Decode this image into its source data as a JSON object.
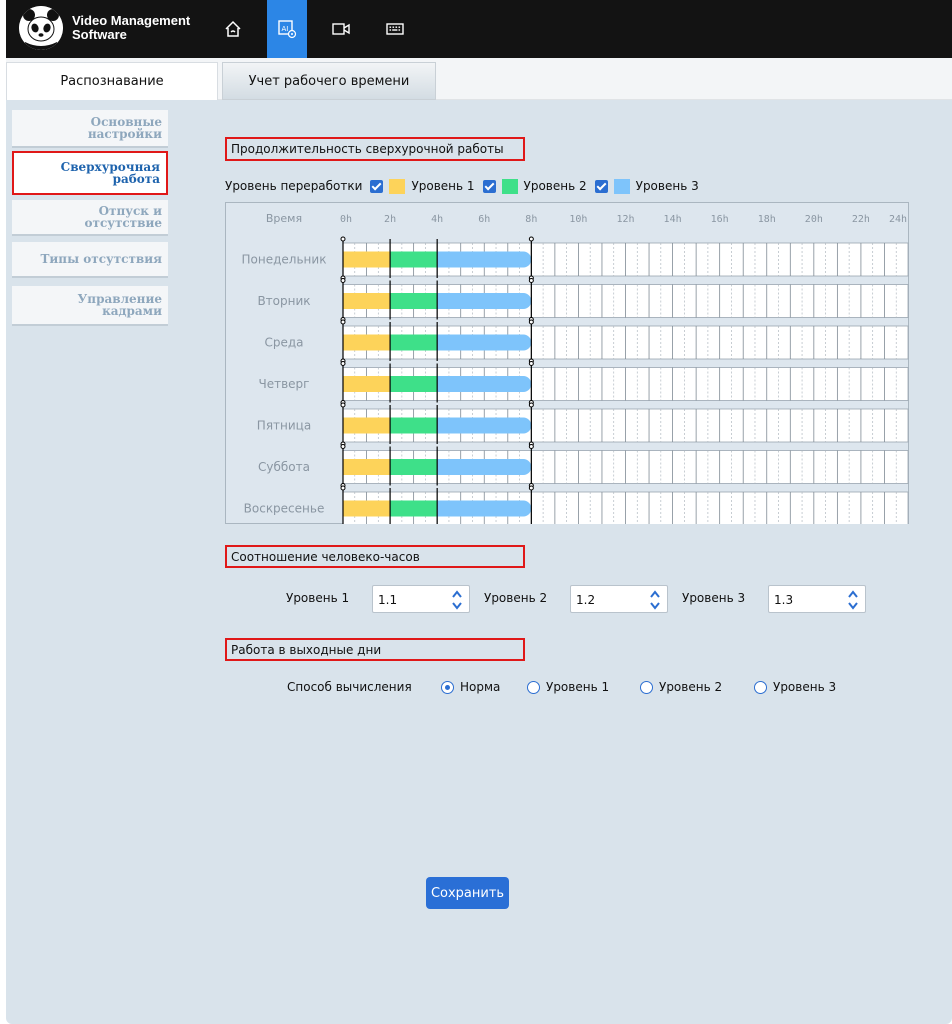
{
  "app": {
    "title_line1": "Video Management",
    "title_line2": "Software",
    "accent_color": "#2c86e6"
  },
  "nav": [
    {
      "icon": "home-icon"
    },
    {
      "icon": "ai-settings-icon",
      "active": true
    },
    {
      "icon": "video-camera-icon"
    },
    {
      "icon": "keyboard-icon"
    }
  ],
  "tabs": [
    {
      "label": "Распознавание",
      "active": true
    },
    {
      "label": "Учет рабочего времени",
      "active": false
    }
  ],
  "sidebar": {
    "items": [
      {
        "line1": "Основные",
        "line2": "настройки"
      },
      {
        "line1": "Сверхурочная",
        "line2": "работа",
        "active": true
      },
      {
        "line1": "Отпуск и",
        "line2": "отсутствие"
      },
      {
        "line1": "Типы отсутствия",
        "line2": ""
      },
      {
        "line1": "Управление",
        "line2": "кадрами"
      }
    ]
  },
  "overtime": {
    "section_title": "Продолжительность сверхурочной работы",
    "level_label": "Уровень переработки",
    "levels": [
      {
        "label": "Уровень 1",
        "checked": true,
        "color": "#fdd35a"
      },
      {
        "label": "Уровень 2",
        "checked": true,
        "color": "#3ee089"
      },
      {
        "label": "Уровень 3",
        "checked": true,
        "color": "#7ec4fb"
      }
    ],
    "time_header": "Время",
    "hour_ticks": [
      "0h",
      "2h",
      "4h",
      "6h",
      "8h",
      "10h",
      "12h",
      "14h",
      "16h",
      "18h",
      "20h",
      "22h",
      "24h"
    ],
    "days": [
      "Понедельник",
      "Вторник",
      "Среда",
      "Четверг",
      "Пятница",
      "Суббота",
      "Воскресенье"
    ],
    "ranges_hours": [
      [
        0,
        2,
        1
      ],
      [
        2,
        4,
        2
      ],
      [
        4,
        8,
        3
      ]
    ]
  },
  "ratio": {
    "section_title": "Соотношение человеко-часов",
    "fields": [
      {
        "label": "Уровень 1",
        "value": "1.1"
      },
      {
        "label": "Уровень 2",
        "value": "1.2"
      },
      {
        "label": "Уровень 3",
        "value": "1.3"
      }
    ]
  },
  "weekend": {
    "section_title": "Работа в выходные дни",
    "method_label": "Способ вычисления",
    "options": [
      {
        "label": "Норма",
        "selected": true
      },
      {
        "label": "Уровень 1",
        "selected": false
      },
      {
        "label": "Уровень 2",
        "selected": false
      },
      {
        "label": "Уровень 3",
        "selected": false
      }
    ]
  },
  "save_label": "Сохранить"
}
